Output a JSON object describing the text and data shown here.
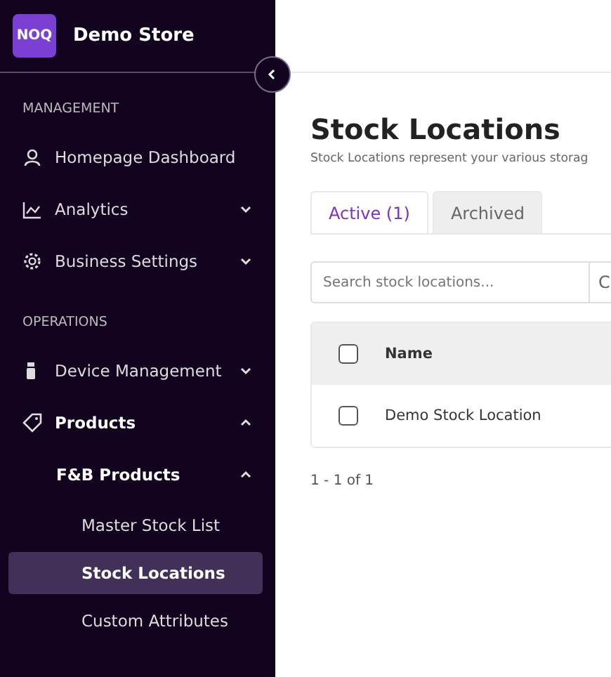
{
  "brand": {
    "logo": "NOQ",
    "store": "Demo Store"
  },
  "sidebar": {
    "sections": [
      {
        "heading": "MANAGEMENT",
        "items": [
          {
            "label": "Homepage Dashboard",
            "selected": false
          },
          {
            "label": "Analytics",
            "expanded": false,
            "selected": false
          },
          {
            "label": "Business Settings",
            "expanded": false,
            "selected": false
          }
        ]
      },
      {
        "heading": "OPERATIONS",
        "items": [
          {
            "label": "Device Management",
            "expanded": false,
            "selected": false
          },
          {
            "label": "Products",
            "expanded": true,
            "selected": false,
            "children": [
              {
                "label": "F&B Products",
                "expanded": true,
                "selected": false,
                "children": [
                  {
                    "label": "Master Stock List",
                    "selected": false
                  },
                  {
                    "label": "Stock Locations",
                    "selected": true
                  },
                  {
                    "label": "Custom Attributes",
                    "selected": false
                  }
                ]
              }
            ]
          }
        ]
      }
    ]
  },
  "page": {
    "title": "Stock Locations",
    "subtitle": "Stock Locations represent your various storag",
    "tabs": [
      {
        "label": "Active (1)",
        "selected": true
      },
      {
        "label": "Archived",
        "selected": false
      }
    ],
    "search": {
      "placeholder": "Search stock locations...",
      "button": "C"
    },
    "table": {
      "columns": [
        "Name"
      ],
      "rows": [
        {
          "checked": false,
          "cells": [
            "Demo Stock Location"
          ]
        }
      ],
      "header_checked": false
    },
    "pagination": "1 - 1 of 1"
  }
}
